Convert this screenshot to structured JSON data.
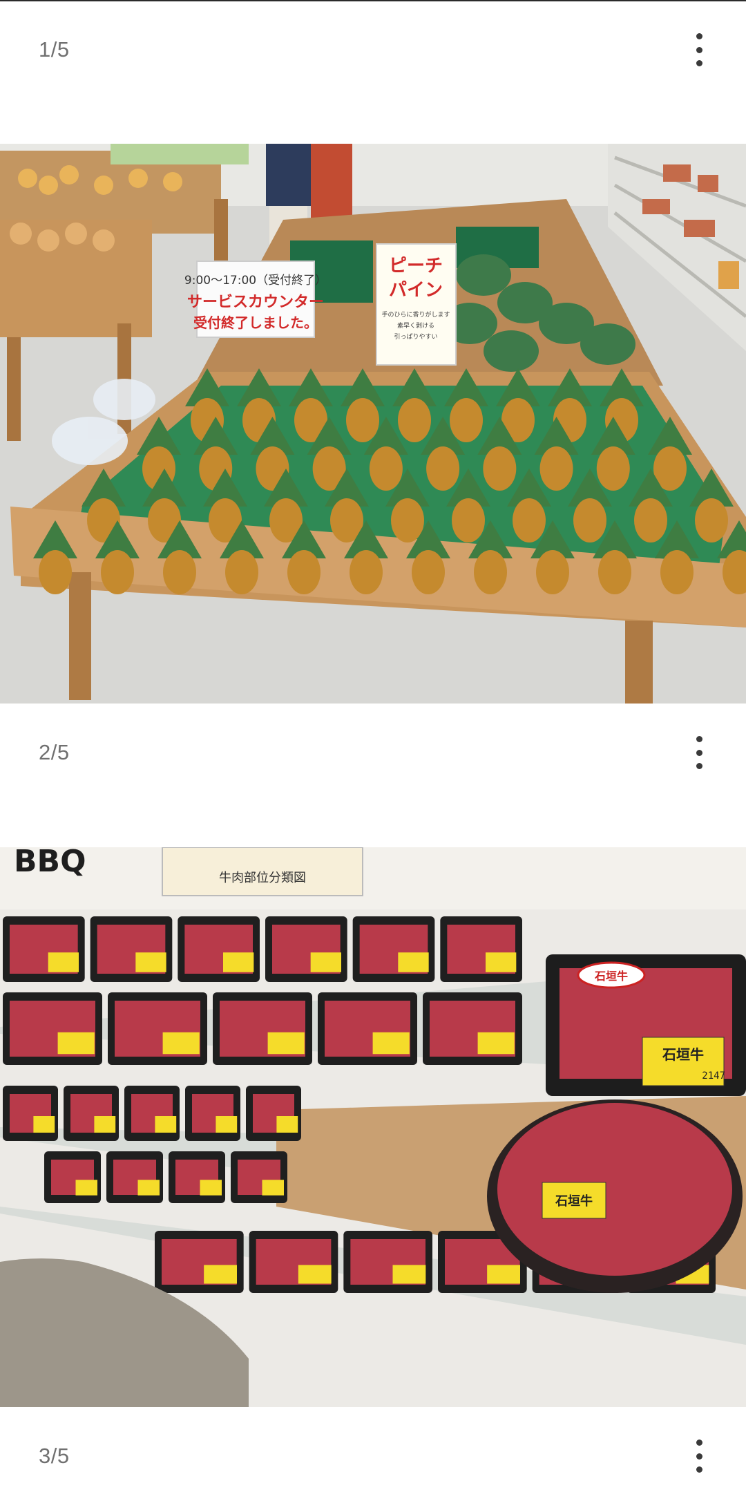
{
  "posts": [
    {
      "counter": "1/5",
      "sign_left_line1": "9:00～17:00（受付終了）",
      "sign_left_line2": "サービスカウンター",
      "sign_left_line3": "受付終了しました。",
      "sign_right_title1": "ピーチ",
      "sign_right_title2": "パイン",
      "sign_right_note1": "手のひらに香りがします",
      "sign_right_note2": "素早く剥ける",
      "sign_right_note3": "引っぱりやすい"
    },
    {
      "counter": "2/5",
      "wall_sign": "BBQ",
      "poster_text": "牛肉部位分類図",
      "label_text": "石垣牛",
      "seal_text": "石垣牛",
      "price_fragment": "2147"
    },
    {
      "counter": "3/5"
    }
  ],
  "icons": {
    "more": "more-vert-icon"
  },
  "colors": {
    "counter_text": "#707070",
    "menu_dots": "#3a3a3a",
    "wood": "#c8955c",
    "green_mat": "#2f8a55",
    "meat": "#b83a4a",
    "label_yellow": "#f5dc2a"
  }
}
